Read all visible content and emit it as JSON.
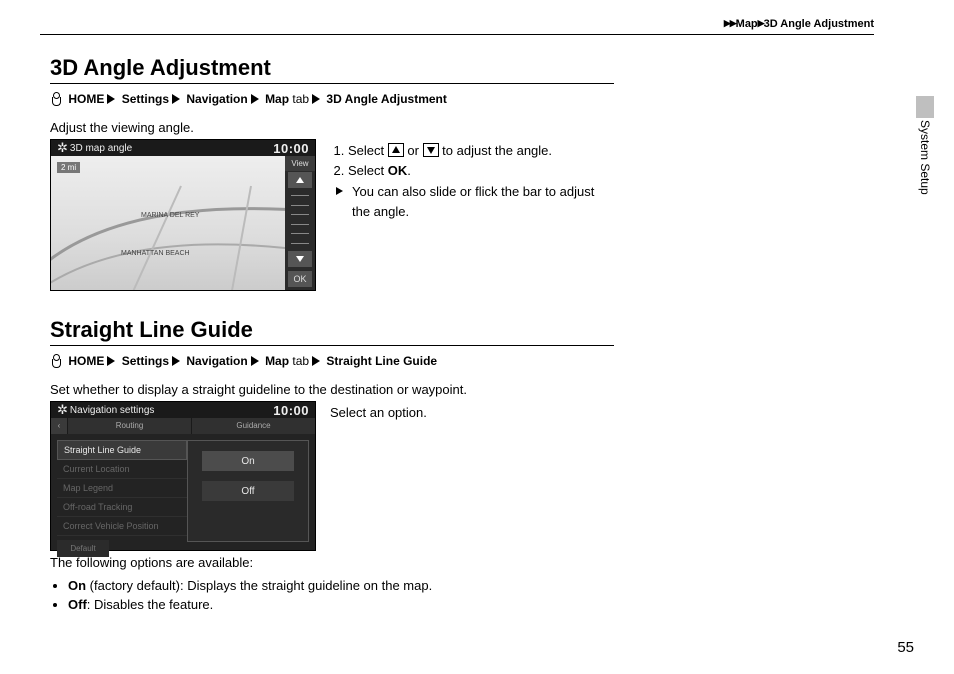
{
  "breadcrumb_top": {
    "arrows": "▶▶",
    "part1": "Map",
    "sep": "▶",
    "part2": "3D Angle Adjustment"
  },
  "side_label": "System Setup",
  "page_number": "55",
  "section1": {
    "title": "3D Angle Adjustment",
    "path": {
      "p1": "HOME",
      "p2": "Settings",
      "p3": "Navigation",
      "p4": "Map",
      "tab": " tab",
      "p5": "3D Angle Adjustment"
    },
    "intro": "Adjust the viewing angle.",
    "shot": {
      "title": "3D map angle",
      "clock": "10:00",
      "view_label": "View",
      "ok": "OK",
      "scale": "2 mi",
      "map_label1": "MARINA DEL REY",
      "map_label2": "MANHATTAN BEACH"
    },
    "steps": {
      "s1a": "Select ",
      "s1b": " or ",
      "s1c": " to adjust the angle.",
      "s2a": "Select ",
      "s2b": "OK",
      "s2c": ".",
      "sub": "You can also slide or flick the bar to adjust the angle."
    }
  },
  "section2": {
    "title": "Straight Line Guide",
    "path": {
      "p1": "HOME",
      "p2": "Settings",
      "p3": "Navigation",
      "p4": "Map",
      "tab": " tab",
      "p5": "Straight Line Guide"
    },
    "intro": "Set whether to display a straight guideline to the destination or waypoint.",
    "shot": {
      "title": "Navigation settings",
      "clock": "10:00",
      "tabs": {
        "t1": "Routing",
        "t2": "Guidance"
      },
      "list": {
        "i1": "Straight Line Guide",
        "i2": "Current Location",
        "i3": "Map Legend",
        "i4": "Off-road Tracking",
        "i5": "Correct Vehicle Position",
        "default": "Default"
      },
      "popup": {
        "on": "On",
        "off": "Off"
      }
    },
    "side_text": "Select an option.",
    "following": "The following options are available:",
    "bullets": {
      "b1a": "On",
      "b1b": " (factory default): Displays the straight guideline on the map.",
      "b2a": "Off",
      "b2b": ": Disables the feature."
    }
  }
}
